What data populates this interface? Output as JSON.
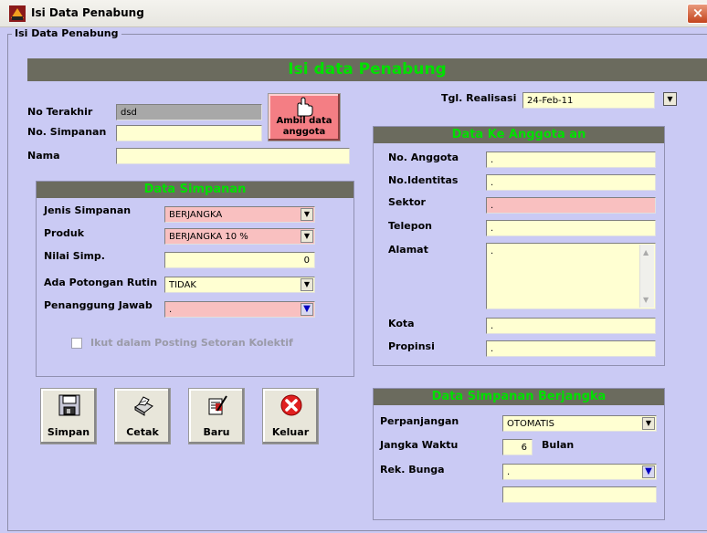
{
  "window": {
    "title": "Isi Data Penabung",
    "close_glyph": "×"
  },
  "frame_label": "Isi Data Penabung",
  "header": "Isi data Penabung",
  "left": {
    "no_terakhir_label": "No Terakhir",
    "no_terakhir_value": "dsd",
    "no_simpanan_label": "No. Simpanan",
    "no_simpanan_value": "",
    "nama_label": "Nama",
    "nama_value": "",
    "ambil_button_label": "Ambil data anggota"
  },
  "tgl": {
    "label": "Tgl. Realisasi",
    "value": "24-Feb-11"
  },
  "data_simpanan": {
    "title": "Data Simpanan",
    "jenis_label": "Jenis Simpanan",
    "jenis_value": "BERJANGKA",
    "produk_label": "Produk",
    "produk_value": "BERJANGKA 10 %",
    "nilai_label": "Nilai Simp.",
    "nilai_value": "0",
    "potongan_label": "Ada Potongan Rutin",
    "potongan_value": "TIDAK",
    "penanggung_label": "Penanggung Jawab",
    "penanggung_value": ".",
    "posting_label": "Ikut dalam Posting Setoran Kolektif"
  },
  "buttons": {
    "simpan": "Simpan",
    "cetak": "Cetak",
    "baru": "Baru",
    "keluar": "Keluar"
  },
  "anggota": {
    "title": "Data Ke Anggota an",
    "no_anggota_label": "No. Anggota",
    "no_anggota_value": ".",
    "identitas_label": "No.Identitas",
    "identitas_value": ".",
    "sektor_label": "Sektor",
    "sektor_value": ".",
    "telepon_label": "Telepon",
    "telepon_value": ".",
    "alamat_label": "Alamat",
    "alamat_value": ".",
    "kota_label": "Kota",
    "kota_value": ".",
    "propinsi_label": "Propinsi",
    "propinsi_value": "."
  },
  "berjangka": {
    "title": "Data Simpanan Berjangka",
    "perpanjangan_label": "Perpanjangan",
    "perpanjangan_value": "OTOMATIS",
    "jangka_label": "Jangka Waktu",
    "jangka_value": "6",
    "jangka_unit": "Bulan",
    "rek_label": "Rek. Bunga",
    "rek_value": ".",
    "rek_extra_value": ""
  },
  "colors": {
    "header_bg": "#6B6B5E",
    "header_text": "#00E000",
    "input_bg": "#FFFFD2",
    "required_bg": "#F9C0C0",
    "form_bg": "#CACAF4",
    "ambil_bg": "#F47E84"
  }
}
